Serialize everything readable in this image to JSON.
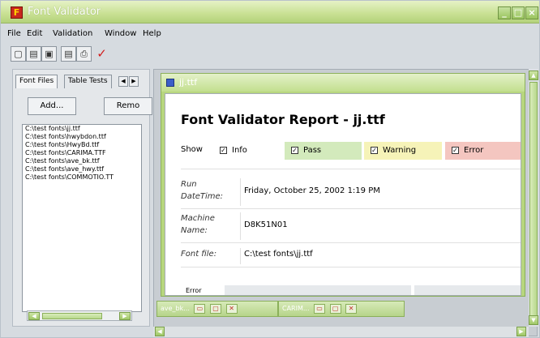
{
  "window": {
    "title": "Font Validator",
    "minimize": "_",
    "maximize": "□",
    "close": "×"
  },
  "menu": [
    "File",
    "Edit",
    "Validation",
    "Window",
    "Help"
  ],
  "toolbar": {
    "buttons": [
      "new-icon",
      "open-icon",
      "save-icon",
      "open-report-icon",
      "print-icon",
      "validate-check-icon"
    ],
    "check_glyph": "✓"
  },
  "left_panel": {
    "tabs": [
      "Font Files",
      "Table Tests"
    ],
    "add_button": "Add...",
    "remove_button": "Remo",
    "files": [
      "C:\\test fonts\\jj.ttf",
      "C:\\test fonts\\hwybdon.ttf",
      "C:\\test fonts\\HwyBd.ttf",
      "C:\\test fonts\\CARIMA.TTF",
      "C:\\test fonts\\ave_bk.ttf",
      "C:\\test fonts\\ave_hwy.ttf",
      "C:\\test fonts\\COMMOTIO.TT"
    ]
  },
  "child_window": {
    "title": "jj.ttf"
  },
  "report": {
    "heading": "Font Validator Report - jj.ttf",
    "show_label": "Show",
    "filters": [
      {
        "label": "Info",
        "checked": true,
        "color": "#ffffff"
      },
      {
        "label": "Pass",
        "checked": true,
        "color": "#d3eabc"
      },
      {
        "label": "Warning",
        "checked": true,
        "color": "#f6f3b8"
      },
      {
        "label": "Error",
        "checked": true,
        "color": "#f4c6c0"
      }
    ],
    "rows": [
      {
        "key": "Run DateTime:",
        "value": "Friday, October 25, 2002 1:19 PM"
      },
      {
        "key": "Machine Name:",
        "value": "D8K51N01"
      },
      {
        "key": "Font file:",
        "value": "C:\\test fonts\\jj.ttf"
      }
    ],
    "error_header": "Error"
  },
  "minimized": [
    {
      "label": "ave_bk..."
    },
    {
      "label": "CARIM..."
    }
  ]
}
